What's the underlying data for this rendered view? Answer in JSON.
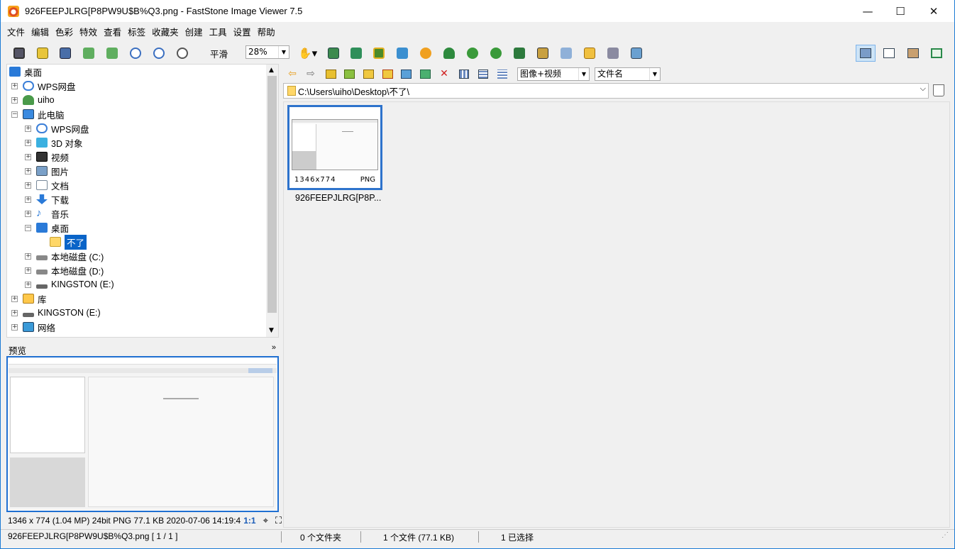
{
  "window": {
    "title": "926FEEPJLRG[P8PW9U$B%Q3.png  -  FastStone Image Viewer 7.5",
    "minimize": "—",
    "maximize": "☐",
    "close": "✕"
  },
  "menu": [
    "文件",
    "编辑",
    "色彩",
    "特效",
    "查看",
    "标签",
    "收藏夹",
    "创建",
    "工具",
    "设置",
    "帮助"
  ],
  "toolbar": {
    "smooth_label": "平滑",
    "smooth_checked": "✓",
    "zoom_value": "28%"
  },
  "tree": {
    "items": [
      {
        "label": "桌面",
        "icon": "desktop-icon"
      },
      {
        "label": "WPS网盘",
        "icon": "cloud-icon"
      },
      {
        "label": "uiho",
        "icon": "user-icon"
      },
      {
        "label": "此电脑",
        "icon": "computer-icon"
      },
      {
        "label": "WPS网盘",
        "icon": "cloud-icon"
      },
      {
        "label": "3D 对象",
        "icon": "3d-objects-icon"
      },
      {
        "label": "视频",
        "icon": "video-icon"
      },
      {
        "label": "图片",
        "icon": "pictures-icon"
      },
      {
        "label": "文档",
        "icon": "documents-icon"
      },
      {
        "label": "下载",
        "icon": "download-icon"
      },
      {
        "label": "音乐",
        "icon": "music-icon"
      },
      {
        "label": "桌面",
        "icon": "desktop-icon"
      },
      {
        "label": "不了",
        "icon": "folder-icon"
      },
      {
        "label": "本地磁盘 (C:)",
        "icon": "drive-icon"
      },
      {
        "label": "本地磁盘 (D:)",
        "icon": "drive-icon"
      },
      {
        "label": "KINGSTON (E:)",
        "icon": "drive-icon"
      },
      {
        "label": "库",
        "icon": "library-icon"
      },
      {
        "label": "KINGSTON (E:)",
        "icon": "drive-icon"
      },
      {
        "label": "网络",
        "icon": "network-icon"
      }
    ]
  },
  "preview": {
    "title": "预览",
    "collapse": "»",
    "info": "1346 x 774 (1.04 MP)  24bit  PNG   77.1 KB   2020-07-06 14:19:4",
    "ratio": "1:1"
  },
  "browser": {
    "filter_value": "图像+视频",
    "sort_value": "文件名",
    "address": "C:\\Users\\uiho\\Desktop\\不了\\"
  },
  "thumbnail": {
    "dimensions": "1346x774",
    "format": "PNG",
    "filename": "926FEEPJLRG[P8P..."
  },
  "status": {
    "file": "926FEEPJLRG[P8PW9U$B%Q3.png [ 1 / 1 ]",
    "folders": "0 个文件夹",
    "files": "1 个文件 (77.1 KB)",
    "selected": "1 已选择"
  }
}
